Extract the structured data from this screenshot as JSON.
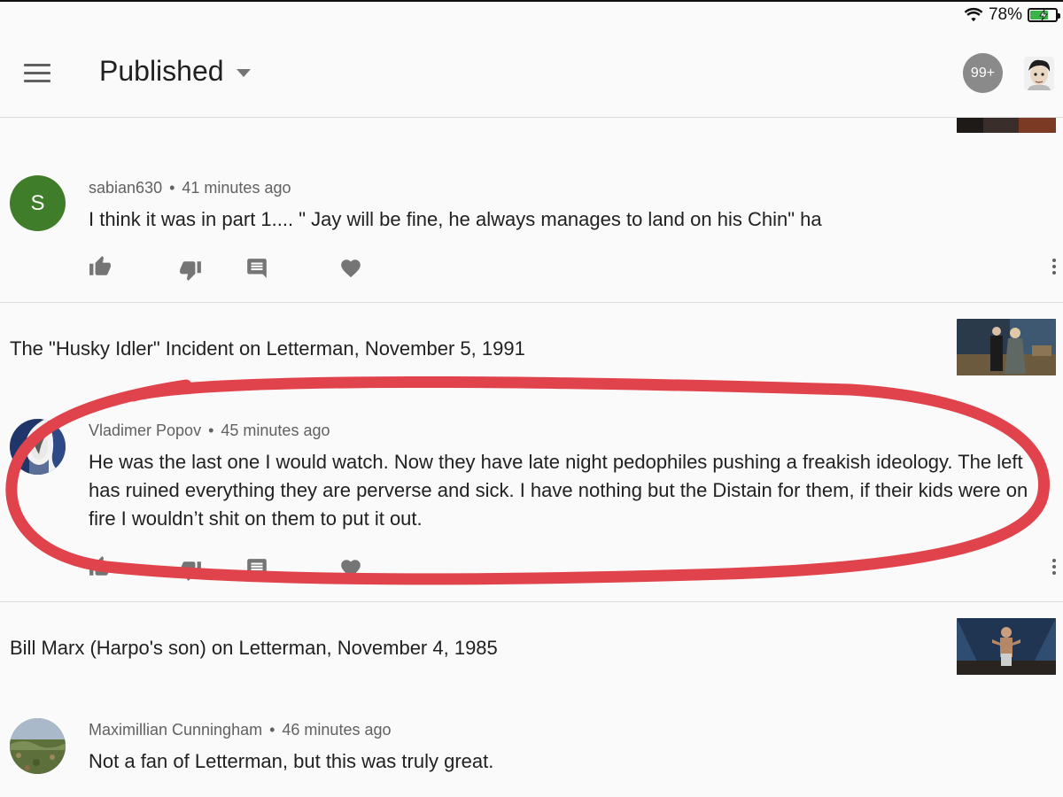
{
  "status": {
    "battery": "78%",
    "battery_level": 0.78
  },
  "header": {
    "title": "Published",
    "notification_badge": "99+"
  },
  "feed": {
    "comments": [
      {
        "avatar_letter": "S",
        "avatar_color": "#3f7d2a",
        "author": "sabian630",
        "separator": "•",
        "time": "41 minutes ago",
        "text": "I think it was in part 1.... \" Jay will be fine, he always manages to land on his Chin\" ha"
      },
      {
        "author": "Vladimer Popov",
        "separator": "•",
        "time": "45 minutes ago",
        "text": "He was the last one I would watch. Now they have late night pedophiles pushing a freakish ideology. The left has ruined everything they are perverse and sick. I have nothing but the Distain for them, if their kids were on fire I wouldn’t shit on them to put it out."
      },
      {
        "author": "Maximillian Cunningham",
        "separator": "•",
        "time": "46 minutes ago",
        "text": "Not a fan of Letterman, but this was truly great."
      }
    ],
    "videos": [
      {
        "title": "The \"Husky Idler\" Incident on Letterman, November 5, 1991"
      },
      {
        "title": "Bill Marx (Harpo's son) on Letterman, November 4, 1985"
      }
    ]
  },
  "colors": {
    "icon_gray": "#757575",
    "annotation_red": "#e0434b",
    "badge_gray": "#8a8a8a"
  },
  "icons": {
    "like": "thumb-up-icon",
    "dislike": "thumb-down-icon",
    "reply": "reply-icon",
    "heart": "heart-icon",
    "more": "more-vert-icon"
  }
}
